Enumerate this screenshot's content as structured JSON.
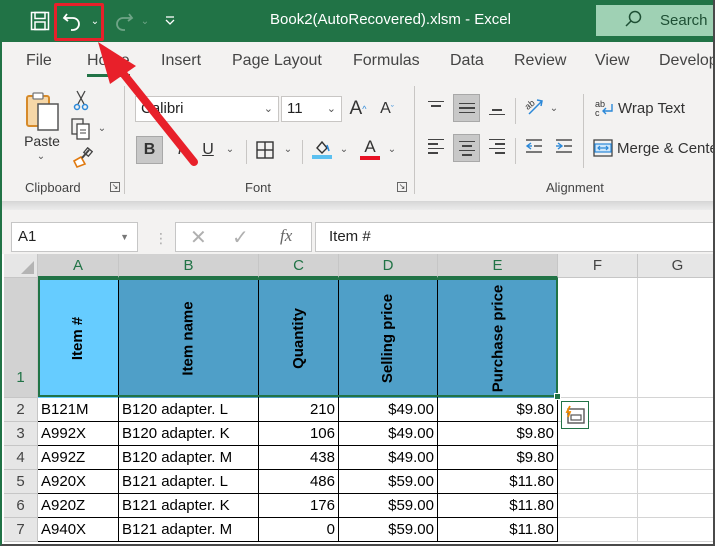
{
  "titlebar": {
    "title": "Book2(AutoRecovered).xlsm  -  Excel",
    "search_label": "Search",
    "qat": [
      "save-icon",
      "undo-icon",
      "redo-icon",
      "customize-qat-icon"
    ]
  },
  "tabs": [
    {
      "label": "File"
    },
    {
      "label": "Home",
      "active": true
    },
    {
      "label": "Insert"
    },
    {
      "label": "Page Layout"
    },
    {
      "label": "Formulas"
    },
    {
      "label": "Data"
    },
    {
      "label": "Review"
    },
    {
      "label": "View"
    },
    {
      "label": "Develop"
    }
  ],
  "ribbon": {
    "clipboard": {
      "label": "Clipboard",
      "paste_label": "Paste"
    },
    "font": {
      "label": "Font",
      "font_name": "Calibri",
      "font_size": "11",
      "bold": "B",
      "italic": "I",
      "underline": "U",
      "fill_color": "#5bc0f0",
      "font_color": "#e81123"
    },
    "alignment": {
      "label": "Alignment",
      "wrap_text": "Wrap Text",
      "merge_center": "Merge & Cente"
    }
  },
  "formula_bar": {
    "name_box": "A1",
    "fx": "fx",
    "content": "Item #"
  },
  "sheet": {
    "columns": [
      "A",
      "B",
      "C",
      "D",
      "E",
      "F",
      "G"
    ],
    "header_row": {
      "row_number": "1",
      "cells": [
        "Item #",
        "Item name",
        "Quantity",
        "Selling price",
        "Purchase price"
      ],
      "fill_a": "#66ccff",
      "fill_rest": "#4f9fc8"
    },
    "rows": [
      {
        "n": "2",
        "item": "B121M",
        "name": "B120 adapter. L",
        "qty": "210",
        "sell": "$49.00",
        "buy": "$9.80"
      },
      {
        "n": "3",
        "item": "A992X",
        "name": "B120 adapter. K",
        "qty": "106",
        "sell": "$49.00",
        "buy": "$9.80"
      },
      {
        "n": "4",
        "item": "A992Z",
        "name": "B120 adapter. M",
        "qty": "438",
        "sell": "$49.00",
        "buy": "$9.80"
      },
      {
        "n": "5",
        "item": "A920X",
        "name": "B121 adapter. L",
        "qty": "486",
        "sell": "$59.00",
        "buy": "$11.80"
      },
      {
        "n": "6",
        "item": "A920Z",
        "name": "B121 adapter. K",
        "qty": "176",
        "sell": "$59.00",
        "buy": "$11.80"
      },
      {
        "n": "7",
        "item": "A940X",
        "name": "B121 adapter. M",
        "qty": "0",
        "sell": "$59.00",
        "buy": "$11.80"
      }
    ]
  },
  "annotation": {
    "color": "#e8202a",
    "target": "undo-button"
  }
}
